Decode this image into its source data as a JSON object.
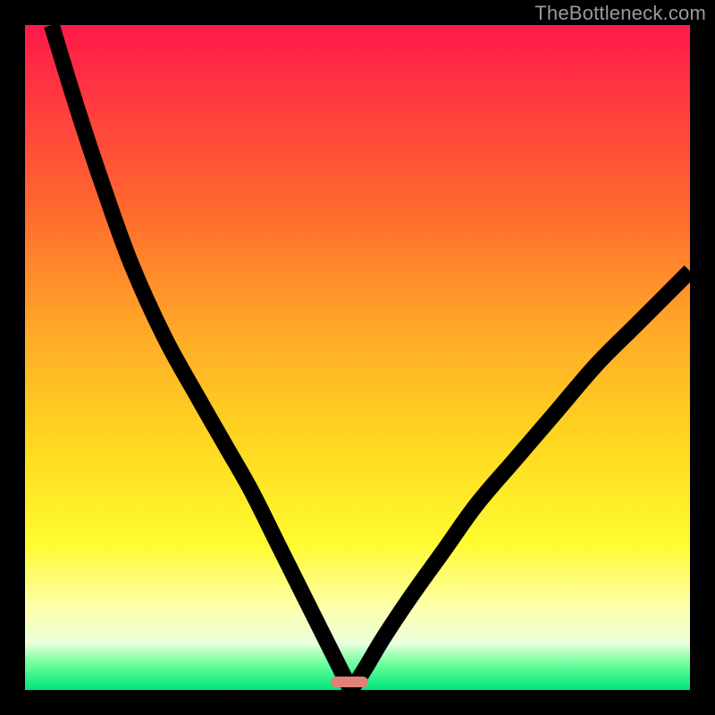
{
  "watermark": {
    "text": "TheBottleneck.com"
  },
  "marker": {
    "color": "#e08078",
    "x_pct": 48.8,
    "y_pct": 98.8
  },
  "chart_data": {
    "type": "line",
    "title": "",
    "xlabel": "",
    "ylabel": "",
    "xlim": [
      0,
      100
    ],
    "ylim": [
      0,
      100
    ],
    "grid": false,
    "legend": false,
    "background_gradient": {
      "direction": "top-to-bottom",
      "stops": [
        {
          "pct": 0,
          "color": "#ff1a4a"
        },
        {
          "pct": 12,
          "color": "#ff3b3f"
        },
        {
          "pct": 28,
          "color": "#ff6a2e"
        },
        {
          "pct": 45,
          "color": "#ffa628"
        },
        {
          "pct": 63,
          "color": "#ffd820"
        },
        {
          "pct": 78,
          "color": "#fffb30"
        },
        {
          "pct": 88,
          "color": "#fdffb0"
        },
        {
          "pct": 93,
          "color": "#e9ffdc"
        },
        {
          "pct": 96,
          "color": "#6fff9e"
        },
        {
          "pct": 100,
          "color": "#00e57a"
        }
      ]
    },
    "series": [
      {
        "name": "left-branch",
        "x": [
          4,
          8,
          12,
          16,
          21,
          26,
          30,
          34,
          38,
          42,
          45,
          47.5,
          49
        ],
        "y": [
          100,
          87,
          75,
          64,
          53,
          44,
          37,
          30,
          22,
          14,
          8,
          3,
          0
        ]
      },
      {
        "name": "right-branch",
        "x": [
          49,
          51,
          54,
          58,
          63,
          68,
          74,
          80,
          86,
          92,
          98,
          100
        ],
        "y": [
          0,
          3,
          8,
          14,
          21,
          28,
          35,
          42,
          49,
          55,
          61,
          63
        ]
      }
    ],
    "marker_point": {
      "x": 49,
      "y": 1.2,
      "color": "#e08078"
    }
  }
}
